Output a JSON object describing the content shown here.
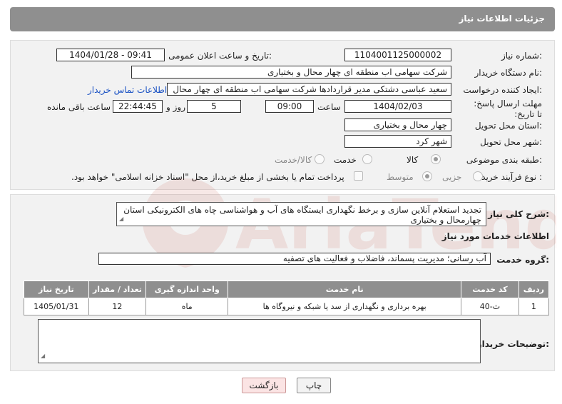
{
  "header": {
    "title": "جزئیات اطلاعات نیاز"
  },
  "fields": {
    "need_number_label": "شماره نیاز:",
    "need_number": "1104001125000002",
    "announce_label": "تاریخ و ساعت اعلان عمومی:",
    "announce_value": "1404/01/28 - 09:41",
    "buyer_label": "نام دستگاه خریدار:",
    "buyer_value": "شرکت سهامی اب منطقه ای چهار محال و بختیاری",
    "creator_label": "ایجاد کننده درخواست:",
    "creator_value": "سعید عباسی دشتکی مدیر قراردادها شرکت سهامی اب منطقه ای چهار محال",
    "contact_link": "اطلاعات تماس خریدار",
    "deadline_label": "مهلت ارسال پاسخ: تا تاریخ:",
    "deadline_date": "1404/02/03",
    "time_label": "ساعت",
    "deadline_time": "09:00",
    "days_value": "5",
    "days_label": "روز و",
    "remaining_time": "22:44:45",
    "remaining_label": "ساعت باقی مانده",
    "province_label": "استان محل تحویل:",
    "province_value": "چهار محال و بختیاری",
    "city_label": "شهر محل تحویل:",
    "city_value": "شهر کرد",
    "category_label": "طبقه بندی موضوعی:",
    "category_options": [
      "کالا",
      "خدمت",
      "کالا/خدمت"
    ],
    "process_label": "نوع فرآیند خرید :",
    "process_options": [
      "جزیی",
      "متوسط"
    ],
    "payment_note": "پرداخت تمام یا بخشی از مبلغ خرید،از محل \"اسناد خزانه اسلامی\" خواهد بود."
  },
  "summary": {
    "label": "شرح کلی نیاز:",
    "text": "تجدید استعلام آنلاین سازی و برخط نگهداری ایستگاه های آب و هواشناسی چاه های الکترونیکی استان چهارمحال و بختیاری"
  },
  "services": {
    "title": "اطلاعات خدمات مورد نیاز",
    "group_label": "گروه خدمت:",
    "group_value": "آب رسانی؛ مدیریت پسماند، فاضلاب و فعالیت های تصفیه",
    "columns": [
      "ردیف",
      "کد خدمت",
      "نام خدمت",
      "واحد اندازه گیری",
      "تعداد / مقدار",
      "تاریخ نیاز"
    ],
    "rows": [
      [
        "1",
        "ث-40",
        "بهره برداری و نگهداری از سد یا شبکه و نیروگاه ها",
        "ماه",
        "12",
        "1405/01/31"
      ]
    ]
  },
  "buyer_notes": {
    "label": "توضیحات خریدار:",
    "text": ""
  },
  "buttons": {
    "print": "چاپ",
    "back": "بازگشت"
  },
  "watermark": {
    "text": "AriaTender.net"
  }
}
